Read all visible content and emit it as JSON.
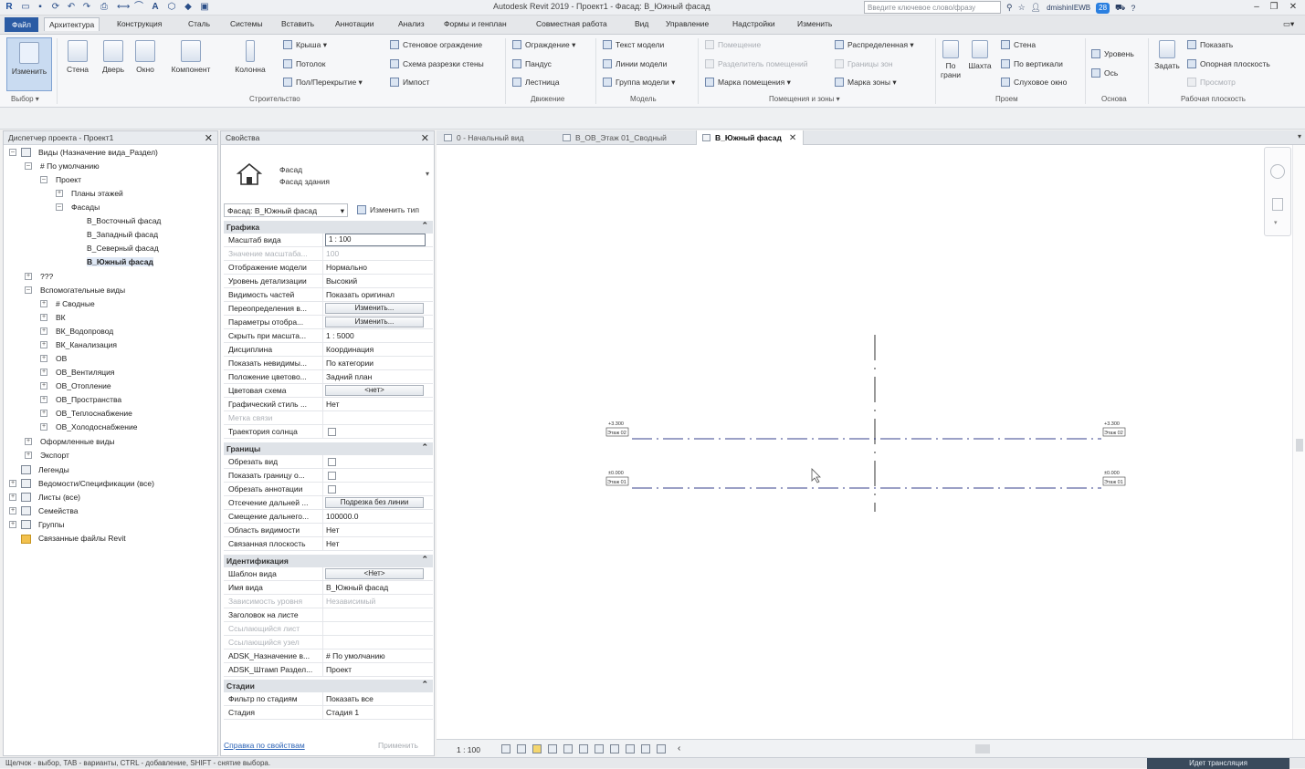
{
  "titlebar": {
    "app_title": "Autodesk Revit 2019 - Проект1 - Фасад: В_Южный фасад",
    "search_placeholder": "Введите ключевое слово/фразу",
    "user": "dmishinIEWB",
    "notifications": "28"
  },
  "menu": {
    "file": "Файл",
    "tabs": [
      "Архитектура",
      "Конструкция",
      "Сталь",
      "Системы",
      "Вставить",
      "Аннотации",
      "Анализ",
      "Формы и генплан",
      "Совместная работа",
      "Вид",
      "Управление",
      "Надстройки",
      "Изменить"
    ]
  },
  "ribbon": {
    "select_group": {
      "modify": "Изменить",
      "label": "Выбор ▾"
    },
    "build_group": {
      "label": "Строительство",
      "large": [
        "Стена",
        "Дверь",
        "Окно",
        "Компонент",
        "Колонна"
      ],
      "small": [
        "Крыша",
        "Потолок",
        "Пол/Перекрытие",
        "Стеновое ограждение",
        "Схема разрезки стены",
        "Импост"
      ]
    },
    "circulation_group": {
      "label": "Движение",
      "items": [
        "Ограждение",
        "Пандус",
        "Лестница"
      ]
    },
    "model_group": {
      "label": "Модель",
      "items": [
        "Текст модели",
        "Линии модели",
        "Группа модели"
      ]
    },
    "room_group": {
      "label": "Помещения и зоны ▾",
      "items": [
        "Помещение",
        "Разделитель помещений",
        "Марка помещения",
        "Распределенная",
        "Границы зон",
        "Марка зоны"
      ]
    },
    "opening_group": {
      "label": "Проем",
      "large": [
        "По грани",
        "Шахта"
      ],
      "items": [
        "Стена",
        "По вертикали",
        "Слуховое окно"
      ]
    },
    "datum_group": {
      "label": "Основа",
      "items": [
        "Уровень",
        "Ось"
      ]
    },
    "workplane_group": {
      "label": "Рабочая плоскость",
      "large": "Задать",
      "items": [
        "Показать",
        "Опорная плоскость",
        "Просмотр"
      ]
    }
  },
  "browser": {
    "title": "Диспетчер проекта - Проект1",
    "nodes": [
      "Виды (Назначение вида_Раздел)",
      "# По умолчанию",
      "Проект",
      "Планы этажей",
      "Фасады",
      "В_Восточный фасад",
      "В_Западный фасад",
      "В_Северный фасад",
      "В_Южный фасад",
      "???",
      "Вспомогательные виды",
      "# Сводные",
      "ВК",
      "ВК_Водопровод",
      "ВК_Канализация",
      "ОВ",
      "ОВ_Вентиляция",
      "ОВ_Отопление",
      "ОВ_Пространства",
      "ОВ_Теплоснабжение",
      "ОВ_Холодоснабжение",
      "Оформленные виды",
      "Экспорт",
      "Легенды",
      "Ведомости/Спецификации (все)",
      "Листы (все)",
      "Семейства",
      "Группы",
      "Связанные файлы Revit"
    ]
  },
  "properties": {
    "title": "Свойства",
    "type_name_1": "Фасад",
    "type_name_2": "Фасад здания",
    "type_selector": "Фасад: В_Южный фасад",
    "edit_type": "Изменить тип",
    "sections": {
      "graphics": "Графика",
      "extents": "Границы",
      "identity": "Идентификация",
      "phasing": "Стадии"
    },
    "rows": [
      {
        "k": "Масштаб вида",
        "v": "1 : 100"
      },
      {
        "k": "Значение масштаба...",
        "v": "100"
      },
      {
        "k": "Отображение модели",
        "v": "Нормально"
      },
      {
        "k": "Уровень детализации",
        "v": "Высокий"
      },
      {
        "k": "Видимость частей",
        "v": "Показать оригинал"
      },
      {
        "k": "Переопределения в...",
        "v": "Изменить..."
      },
      {
        "k": "Параметры отобра...",
        "v": "Изменить..."
      },
      {
        "k": "Скрыть при масшта...",
        "v": "1 : 5000"
      },
      {
        "k": "Дисциплина",
        "v": "Координация"
      },
      {
        "k": "Показать невидимы...",
        "v": "По категории"
      },
      {
        "k": "Положение цветово...",
        "v": "Задний план"
      },
      {
        "k": "Цветовая схема",
        "v": "<нет>"
      },
      {
        "k": "Графический стиль ...",
        "v": "Нет"
      },
      {
        "k": "Метка связи",
        "v": ""
      },
      {
        "k": "Траектория солнца",
        "v": ""
      },
      {
        "k": "Обрезать вид",
        "v": ""
      },
      {
        "k": "Показать границу о...",
        "v": ""
      },
      {
        "k": "Обрезать аннотации",
        "v": ""
      },
      {
        "k": "Отсечение дальней ...",
        "v": "Подрезка без линии"
      },
      {
        "k": "Смещение дальнего...",
        "v": "100000.0"
      },
      {
        "k": "Область видимости",
        "v": "Нет"
      },
      {
        "k": "Связанная плоскость",
        "v": "Нет"
      },
      {
        "k": "Шаблон вида",
        "v": "<Нет>"
      },
      {
        "k": "Имя вида",
        "v": "В_Южный фасад"
      },
      {
        "k": "Зависимость уровня",
        "v": "Независимый"
      },
      {
        "k": "Заголовок на листе",
        "v": ""
      },
      {
        "k": "Ссылающийся лист",
        "v": ""
      },
      {
        "k": "Ссылающийся узел",
        "v": ""
      },
      {
        "k": "ADSK_Назначение в...",
        "v": "# По умолчанию"
      },
      {
        "k": "ADSK_Штамп Раздел...",
        "v": "Проект"
      },
      {
        "k": "Фильтр по стадиям",
        "v": "Показать все"
      },
      {
        "k": "Стадия",
        "v": "Стадия 1"
      }
    ],
    "help": "Справка по свойствам",
    "apply": "Применить"
  },
  "view_tabs": [
    "0 - Начальный вид",
    "В_ОВ_Этаж 01_Сводный",
    "В_Южный фасад"
  ],
  "canvas": {
    "level_top_elev": "+3.300",
    "level_top_name": "Этаж 02",
    "level_bot_elev": "±0.000",
    "level_bot_name": "Этаж 01"
  },
  "view_bar": {
    "scale": "1 : 100"
  },
  "status": {
    "text": "Щелчок - выбор, TAB - варианты, CTRL - добавление, SHIFT - снятие выбора.",
    "translation": "Идет трансляция"
  }
}
